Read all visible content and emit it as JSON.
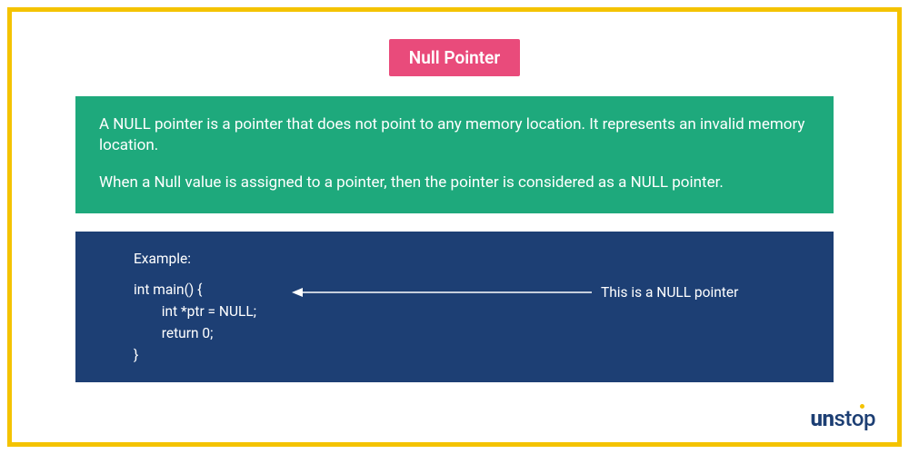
{
  "title": "Null Pointer",
  "description": {
    "para1": "A NULL pointer is a pointer that does not point to any memory location. It represents an invalid memory location.",
    "para2": "When a Null value is assigned to a pointer, then the pointer is considered as a NULL pointer."
  },
  "example": {
    "label": "Example:",
    "code_line1": "int main() {",
    "code_line2": "        int *ptr = NULL;",
    "code_line3": "        return 0;",
    "code_line4": "}",
    "annotation": "This is a NULL pointer"
  },
  "logo": {
    "part1": "un",
    "part2": "stop"
  },
  "colors": {
    "frame": "#f4c300",
    "title_bg": "#e94b7b",
    "desc_bg": "#1ea97c",
    "example_bg": "#1d3f74",
    "logo": "#1d3f74"
  }
}
